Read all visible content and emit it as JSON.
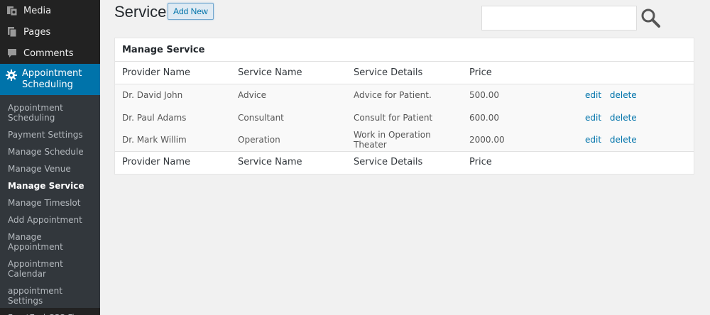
{
  "sidebar": {
    "top_items": [
      {
        "label": "Media",
        "icon": "media-icon"
      },
      {
        "label": "Pages",
        "icon": "pages-icon"
      },
      {
        "label": "Comments",
        "icon": "comments-icon"
      }
    ],
    "active_item": {
      "label": "Appointment Scheduling",
      "icon": "gear-icon"
    },
    "submenu": [
      "Appointment Scheduling",
      "Payment Settings",
      "Manage Schedule",
      "Manage Venue",
      "Manage Service",
      "Manage Timeslot",
      "Add Appointment",
      "Manage Appointment",
      "Appointment Calendar",
      "appointment Settings",
      "FrontEnd CSS Fix"
    ],
    "current_submenu": "Manage Service"
  },
  "header": {
    "title": "Service",
    "add_new_label": "Add New",
    "search_value": ""
  },
  "panel": {
    "title": "Manage Service",
    "columns": [
      "Provider Name",
      "Service Name",
      "Service Details",
      "Price"
    ],
    "rows": [
      {
        "provider": "Dr. David John",
        "service": "Advice",
        "details": "Advice for Patient.",
        "price": "500.00",
        "edit": "edit",
        "delete": "delete"
      },
      {
        "provider": "Dr. Paul Adams",
        "service": "Consultant",
        "details": "Consult for Patient",
        "price": "600.00",
        "edit": "edit",
        "delete": "delete"
      },
      {
        "provider": "Dr. Mark Willim",
        "service": "Operation",
        "details": "Work in Operation Theater",
        "price": "2000.00",
        "edit": "edit",
        "delete": "delete"
      }
    ]
  },
  "colors": {
    "sidebar_bg": "#222222",
    "submenu_bg": "#32373c",
    "accent": "#0073aa",
    "page_bg": "#f1f1f1"
  }
}
